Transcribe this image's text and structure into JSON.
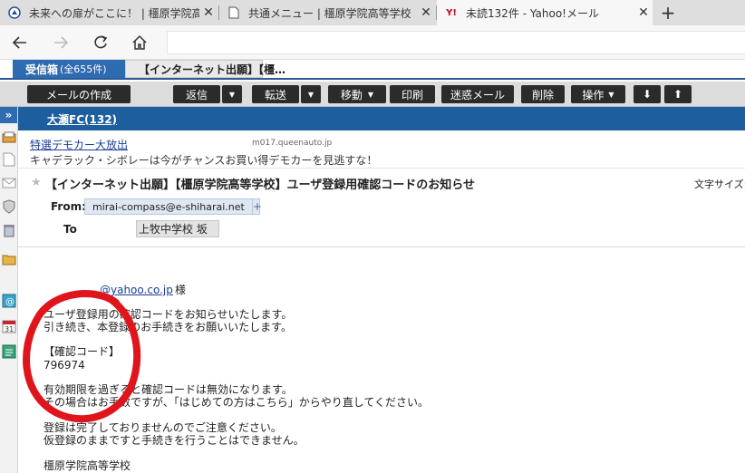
{
  "browser": {
    "tabs": [
      {
        "title": "未来への扉がここに！ | 橿原学院高",
        "icon": "school-crest-icon"
      },
      {
        "title": "共通メニュー | 橿原学院高等学校",
        "icon": "document-icon"
      },
      {
        "title": "未読132件 - Yahoo!メール",
        "icon": "yahoo-icon"
      }
    ],
    "new_tab": "+",
    "icons": {
      "back": "arrow-left-icon",
      "forward": "arrow-right-icon",
      "reload": "reload-icon",
      "home": "home-icon"
    }
  },
  "mail_tabs": {
    "inbox_label": "受信箱",
    "inbox_count": "(全655件)",
    "open_mail_tab": "【インターネット出願】【橿…"
  },
  "toolbar": {
    "compose": "メールの作成",
    "reply": "返信",
    "forward": "転送",
    "move": "移動",
    "print": "印刷",
    "spam": "迷惑メール",
    "delete": "削除",
    "action": "操作",
    "down": "⬇",
    "up": "⬆"
  },
  "folder": {
    "name": "大瀬FC(132)"
  },
  "ad": {
    "link": "特選デモカー大放出",
    "domain": "m017.queenauto.jp",
    "text": "キャデラック・シボレーは今がチャンスお買い得デモカーを見逃すな！"
  },
  "message": {
    "subject": "【インターネット出願】【橿原学院高等学校】ユーザ登録用確認コードのお知らせ",
    "text_size_label": "文字サイズ:",
    "from_label": "From:",
    "from_address": "mirai-compass@e-shiharai.net",
    "to_label": "To",
    "to_name": "上牧中学校 坂"
  },
  "body": {
    "greeting_address": "@yahoo.co.jp",
    "greeting_suffix": "様",
    "lines": [
      "ユーザ登録用の確認コードをお知らせいたします。",
      "引き続き、本登録のお手続きをお願いいたします。",
      "【確認コード】",
      "796974",
      "有効期限を過ぎると確認コードは無効になります。",
      "その場合はお手数ですが、「はじめての方はこちら」からやり直してください。",
      "登録は完了しておりませんのでご注意ください。",
      "仮登録のままですと手続きを行うことはできません。",
      "橿原学院高等学校"
    ]
  },
  "annotation": {
    "color": "#e0141b"
  }
}
